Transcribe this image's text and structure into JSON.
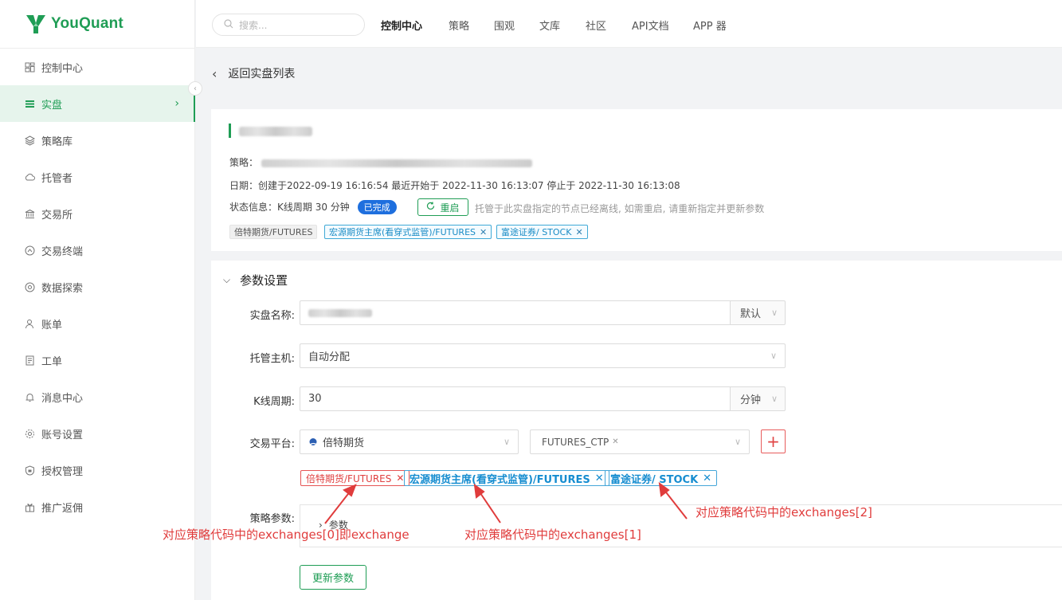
{
  "brand": {
    "name": "YouQuant",
    "color": "#1f9d55"
  },
  "sidebar": {
    "items": [
      {
        "label": "控制中心",
        "icon": "dashboard-icon"
      },
      {
        "label": "实盘",
        "icon": "live-trading-icon",
        "active": true
      },
      {
        "label": "策略库",
        "icon": "strategy-library-icon"
      },
      {
        "label": "托管者",
        "icon": "cloud-icon"
      },
      {
        "label": "交易所",
        "icon": "bank-icon"
      },
      {
        "label": "交易终端",
        "icon": "terminal-icon"
      },
      {
        "label": "数据探索",
        "icon": "compass-icon"
      },
      {
        "label": "账单",
        "icon": "user-icon"
      },
      {
        "label": "工单",
        "icon": "ticket-icon"
      },
      {
        "label": "消息中心",
        "icon": "bell-icon"
      },
      {
        "label": "账号设置",
        "icon": "gear-icon"
      },
      {
        "label": "授权管理",
        "icon": "shield-icon"
      },
      {
        "label": "推广返佣",
        "icon": "gift-icon"
      }
    ]
  },
  "topbar": {
    "search_placeholder": "搜索...",
    "nav": [
      "控制中心",
      "策略",
      "围观",
      "文库",
      "社区",
      "API文档",
      "APP 器"
    ]
  },
  "back_label": "返回实盘列表",
  "detail": {
    "strategy_label": "策略：",
    "date_label": "日期：",
    "date_text": "创建于2022-09-19 16:16:54 最近开始于 2022-11-30 16:13:07 停止于 2022-11-30 16:13:08",
    "status_label": "状态信息：",
    "status_text": "K线周期 30 分钟",
    "status_badge": "已完成",
    "restart_label": "重启",
    "hint": "托管于此实盘指定的节点已经离线, 如需重启, 请重新指定并更新参数",
    "tags": [
      {
        "label": "倍特期货/FUTURES",
        "style": "gray"
      },
      {
        "label": "宏源期货主席(看穿式监管)/FUTURES",
        "style": "cyan"
      },
      {
        "label": "富途证券/ STOCK",
        "style": "cyan"
      }
    ]
  },
  "params": {
    "section_title": "参数设置",
    "name_label": "实盘名称:",
    "name_addon": "默认",
    "host_label": "托管主机:",
    "host_value": "自动分配",
    "period_label": "K线周期:",
    "period_value": "30",
    "period_unit": "分钟",
    "platform_label": "交易平台:",
    "platform_value": "倍特期货",
    "platform_type": "FUTURES_CTP",
    "chips": [
      {
        "label": "倍特期货/FUTURES",
        "style": "red"
      },
      {
        "label": "宏源期货主席(看穿式监管)/FUTURES",
        "style": "blue"
      },
      {
        "label": "富途证券/ STOCK",
        "style": "blue"
      }
    ],
    "strategy_params_label": "策略参数:",
    "strategy_params_toggle": "参数",
    "update_button": "更新参数"
  },
  "annotations": [
    "对应策略代码中的exchanges[0]即exchange",
    "对应策略代码中的exchanges[1]",
    "对应策略代码中的exchanges[2]"
  ],
  "colors": {
    "accent": "#1f9d55",
    "annotation": "#e03c3c",
    "tag_blue": "#168dd0",
    "badge_blue": "#1e6fde"
  }
}
